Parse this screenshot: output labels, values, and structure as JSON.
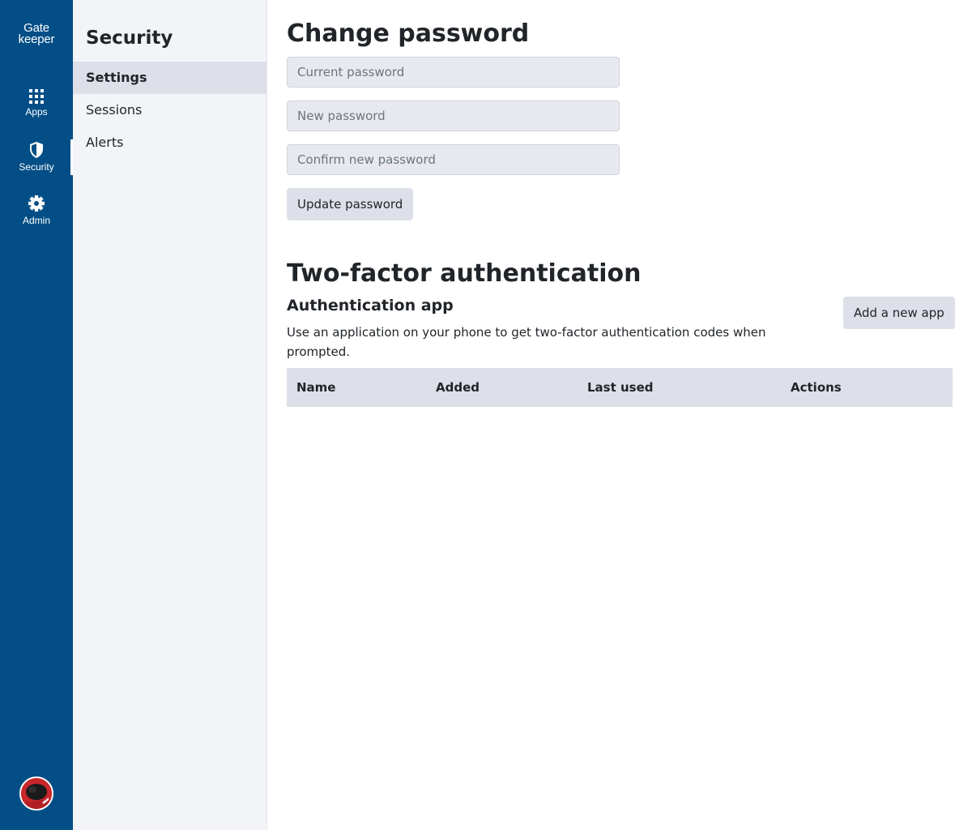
{
  "brand": {
    "line1": "Gate",
    "line2": "keeper"
  },
  "rail": {
    "items": [
      {
        "label": "Apps",
        "icon": "grid-icon"
      },
      {
        "label": "Security",
        "icon": "shield-icon"
      },
      {
        "label": "Admin",
        "icon": "gear-icon"
      }
    ],
    "active": "Security"
  },
  "subnav": {
    "title": "Security",
    "items": [
      {
        "label": "Settings"
      },
      {
        "label": "Sessions"
      },
      {
        "label": "Alerts"
      }
    ],
    "active": "Settings"
  },
  "change_password": {
    "title": "Change password",
    "current_placeholder": "Current password",
    "new_placeholder": "New password",
    "confirm_placeholder": "Confirm new password",
    "submit_label": "Update password"
  },
  "two_factor": {
    "title": "Two-factor authentication",
    "section_title": "Authentication app",
    "description": "Use an application on your phone to get two-factor authentication codes when prompted.",
    "add_label": "Add a new app",
    "columns": [
      "Name",
      "Added",
      "Last used",
      "Actions"
    ]
  },
  "colors": {
    "rail": "#034e86",
    "sidebar": "#f3f4f8",
    "active_item": "#dde0e8",
    "avatar": "#c8262b"
  }
}
